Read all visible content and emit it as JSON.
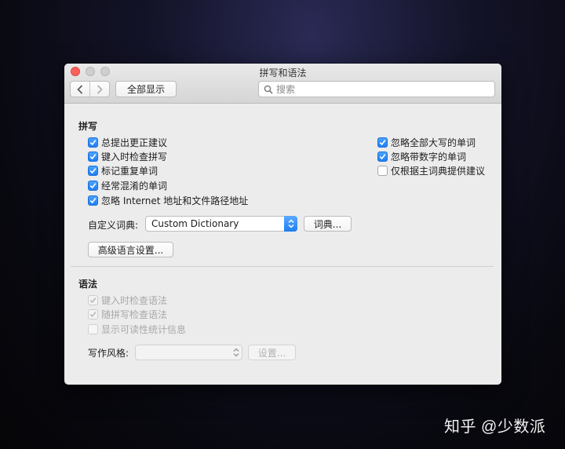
{
  "window": {
    "title": "拼写和语法"
  },
  "toolbar": {
    "back_icon": "chevron-left-icon",
    "forward_icon": "chevron-right-icon",
    "show_all_label": "全部显示",
    "search_placeholder": "搜索"
  },
  "spelling": {
    "title": "拼写",
    "left_options": [
      {
        "label": "总提出更正建议",
        "checked": true
      },
      {
        "label": "键入时检查拼写",
        "checked": true
      },
      {
        "label": "标记重复单词",
        "checked": true
      },
      {
        "label": "经常混淆的单词",
        "checked": true
      },
      {
        "label": "忽略 Internet 地址和文件路径地址",
        "checked": true
      }
    ],
    "right_options": [
      {
        "label": "忽略全部大写的单词",
        "checked": true
      },
      {
        "label": "忽略带数字的单词",
        "checked": true
      },
      {
        "label": "仅根据主词典提供建议",
        "checked": false
      }
    ],
    "dictionary_label": "自定义词典:",
    "dictionary_value": "Custom Dictionary",
    "dictionary_button": "词典...",
    "advanced_button": "高级语言设置..."
  },
  "grammar": {
    "title": "语法",
    "options": [
      {
        "label": "键入时检查语法",
        "checked": true,
        "enabled": false
      },
      {
        "label": "随拼写检查语法",
        "checked": true,
        "enabled": false
      },
      {
        "label": "显示可读性统计信息",
        "checked": false,
        "enabled": false
      }
    ],
    "style_label": "写作风格:",
    "style_value": "",
    "settings_button": "设置..."
  },
  "watermark": "知乎 @少数派",
  "colors": {
    "accent": "#1f7ff4",
    "close": "#fc605c"
  }
}
